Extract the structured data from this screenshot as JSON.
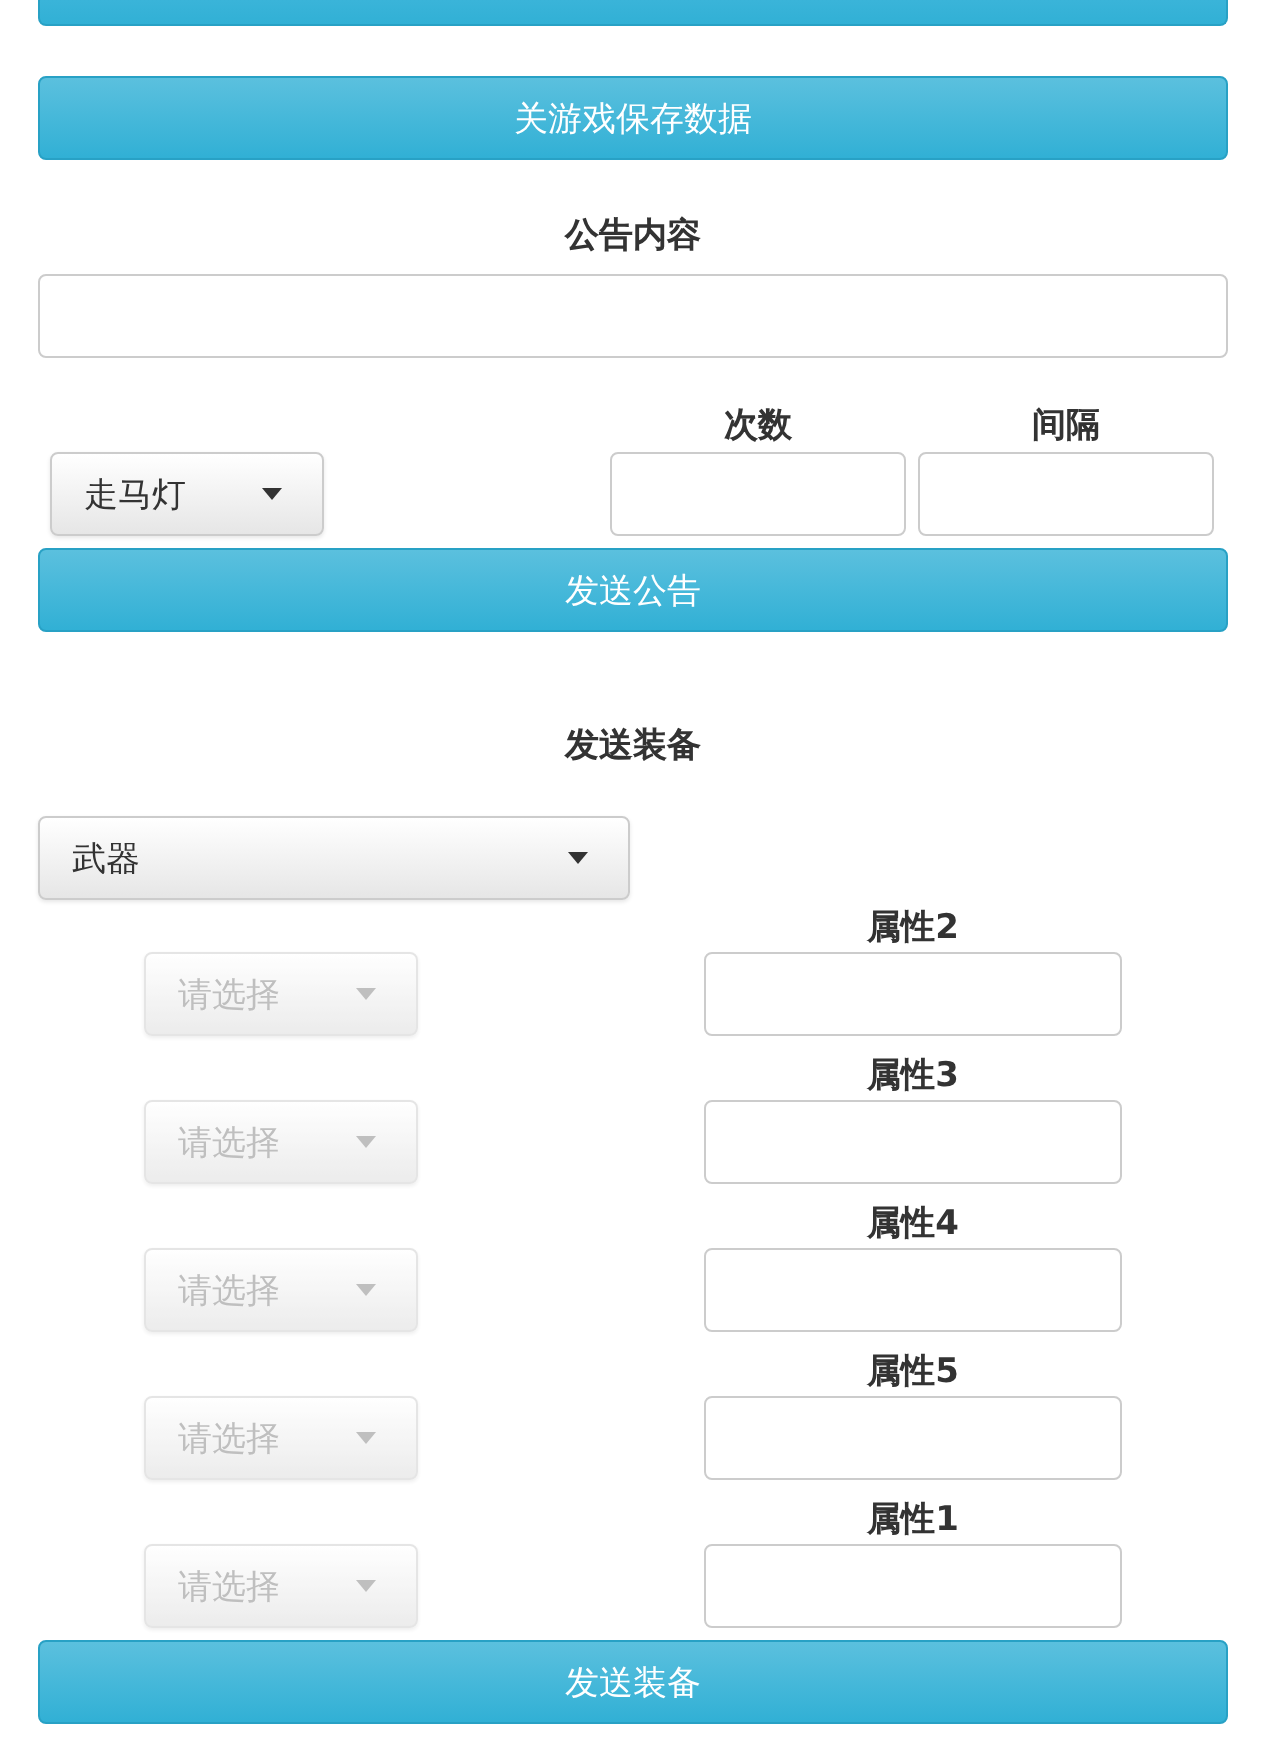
{
  "save_button": {
    "label": "关游戏保存数据"
  },
  "notice": {
    "title": "公告内容",
    "type_select": {
      "value": "走马灯"
    },
    "count_label": "次数",
    "interval_label": "间隔",
    "send_button": "发送公告"
  },
  "equipment": {
    "title": "发送装备",
    "category_select": {
      "value": "武器"
    },
    "attributes": [
      {
        "select": "请选择",
        "disabled": true,
        "label": "属性2"
      },
      {
        "select": "请选择",
        "disabled": true,
        "label": "属性3"
      },
      {
        "select": "请选择",
        "disabled": true,
        "label": "属性4"
      },
      {
        "select": "请选择",
        "disabled": true,
        "label": "属性5"
      },
      {
        "select": "请选择",
        "disabled": true,
        "label": "属性1"
      }
    ],
    "send_button": "发送装备"
  }
}
